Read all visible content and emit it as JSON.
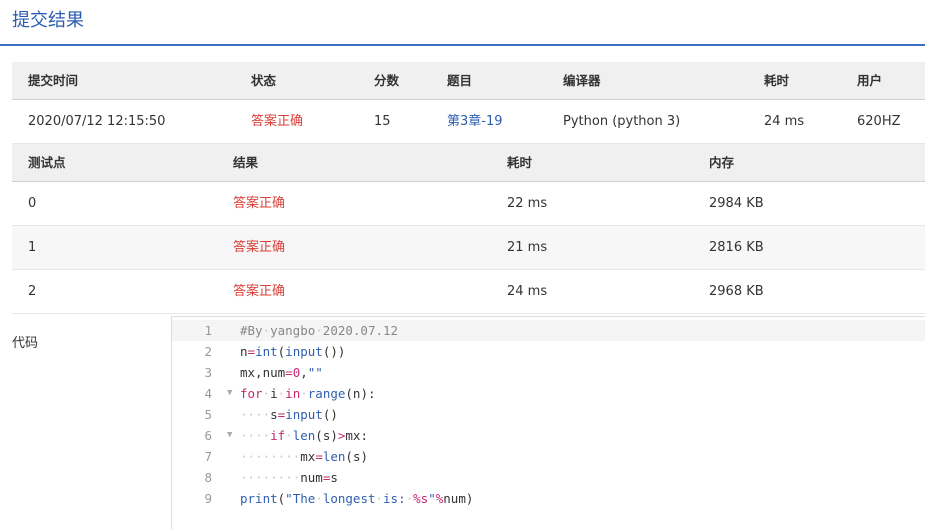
{
  "page": {
    "title": "提交结果"
  },
  "submission": {
    "headers": [
      "提交时间",
      "状态",
      "分数",
      "题目",
      "编译器",
      "耗时",
      "用户"
    ],
    "row": {
      "time": "2020/07/12 12:15:50",
      "status": "答案正确",
      "score": "15",
      "problem": "第3章-19",
      "compiler": "Python (python 3)",
      "duration": "24 ms",
      "user": "620HZ"
    }
  },
  "testcases": {
    "headers": [
      "测试点",
      "结果",
      "耗时",
      "内存"
    ],
    "rows": [
      {
        "id": "0",
        "result": "答案正确",
        "time": "22 ms",
        "memory": "2984 KB"
      },
      {
        "id": "1",
        "result": "答案正确",
        "time": "21 ms",
        "memory": "2816 KB"
      },
      {
        "id": "2",
        "result": "答案正确",
        "time": "24 ms",
        "memory": "2968 KB"
      }
    ]
  },
  "code": {
    "label": "代码",
    "line_numbers": [
      "1",
      "2",
      "3",
      "4",
      "5",
      "6",
      "7",
      "8",
      "9"
    ],
    "lines": [
      "#By yangbo 2020.07.12",
      "n=int(input())",
      "mx,num=0,\"\"",
      "for i in range(n):",
      "    s=input()",
      "    if len(s)>mx:",
      "        mx=len(s)",
      "        num=s",
      "print(\"The longest is: %s\"%num)"
    ],
    "fold_markers": [
      "",
      "",
      "",
      "▼",
      "",
      "▼",
      "",
      "",
      ""
    ],
    "colors": {
      "keyword": "#c6286e",
      "builtin": "#2f5fae",
      "comment": "#888888",
      "success": "#d9403a",
      "accent": "#2a5db0"
    }
  }
}
